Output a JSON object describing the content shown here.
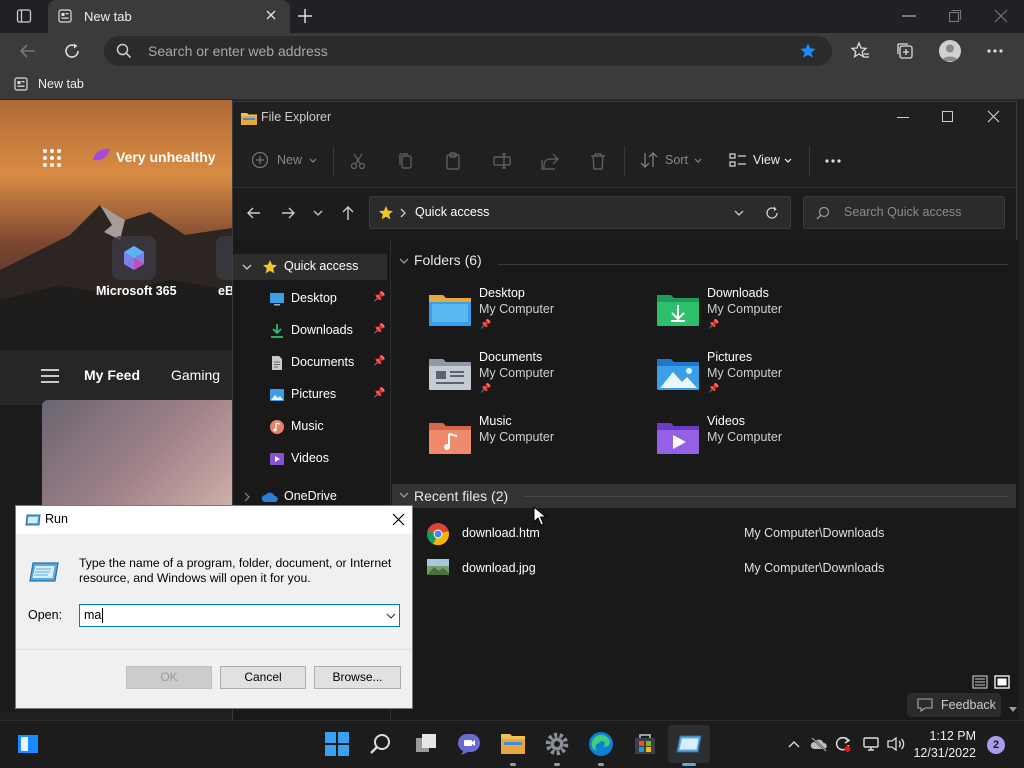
{
  "browser": {
    "tab_title": "New tab",
    "search_placeholder": "Search or enter web address",
    "favorites_item": "New tab"
  },
  "newtab": {
    "weather_text": "Very unhealthy",
    "app_tile_label": "Microsoft 365",
    "app_tile_label_partial": "eB",
    "feed_tabs": [
      "My Feed",
      "Gaming"
    ]
  },
  "explorer": {
    "title": "File Explorer",
    "toolbar": {
      "new_label": "New",
      "sort_label": "Sort",
      "view_label": "View"
    },
    "path": "Quick access",
    "search_placeholder": "Search Quick access",
    "nav": {
      "quick_access": "Quick access",
      "items": [
        {
          "label": "Desktop",
          "pinned": true,
          "icon": "desktop-icon"
        },
        {
          "label": "Downloads",
          "pinned": true,
          "icon": "downloads-icon"
        },
        {
          "label": "Documents",
          "pinned": true,
          "icon": "documents-icon"
        },
        {
          "label": "Pictures",
          "pinned": true,
          "icon": "pictures-icon"
        },
        {
          "label": "Music",
          "pinned": false,
          "icon": "music-icon"
        },
        {
          "label": "Videos",
          "pinned": false,
          "icon": "videos-icon"
        }
      ],
      "onedrive": "OneDrive"
    },
    "folders_header": "Folders (6)",
    "folders": [
      {
        "name": "Desktop",
        "location": "My Computer",
        "pinned": true
      },
      {
        "name": "Downloads",
        "location": "My Computer",
        "pinned": true
      },
      {
        "name": "Documents",
        "location": "My Computer",
        "pinned": true
      },
      {
        "name": "Pictures",
        "location": "My Computer",
        "pinned": true
      },
      {
        "name": "Music",
        "location": "My Computer",
        "pinned": false
      },
      {
        "name": "Videos",
        "location": "My Computer",
        "pinned": false
      }
    ],
    "recent_header": "Recent files (2)",
    "recent": [
      {
        "name": "download.htm",
        "location": "My Computer\\Downloads"
      },
      {
        "name": "download.jpg",
        "location": "My Computer\\Downloads"
      }
    ]
  },
  "run_dialog": {
    "title": "Run",
    "description": "Type the name of a program, folder, document, or Internet resource, and Windows will open it for you.",
    "open_label": "Open:",
    "input_value": "ma",
    "ok": "OK",
    "cancel": "Cancel",
    "browse": "Browse..."
  },
  "feedback_label": "Feedback",
  "taskbar": {
    "time": "1:12 PM",
    "date": "12/31/2022",
    "notification_count": "2"
  },
  "colors": {
    "accent_blue": "#0078d7",
    "folder_yellow": "#f2c14e",
    "star_yellow": "#f4c430",
    "favorite_star_blue": "#1a8cff"
  }
}
